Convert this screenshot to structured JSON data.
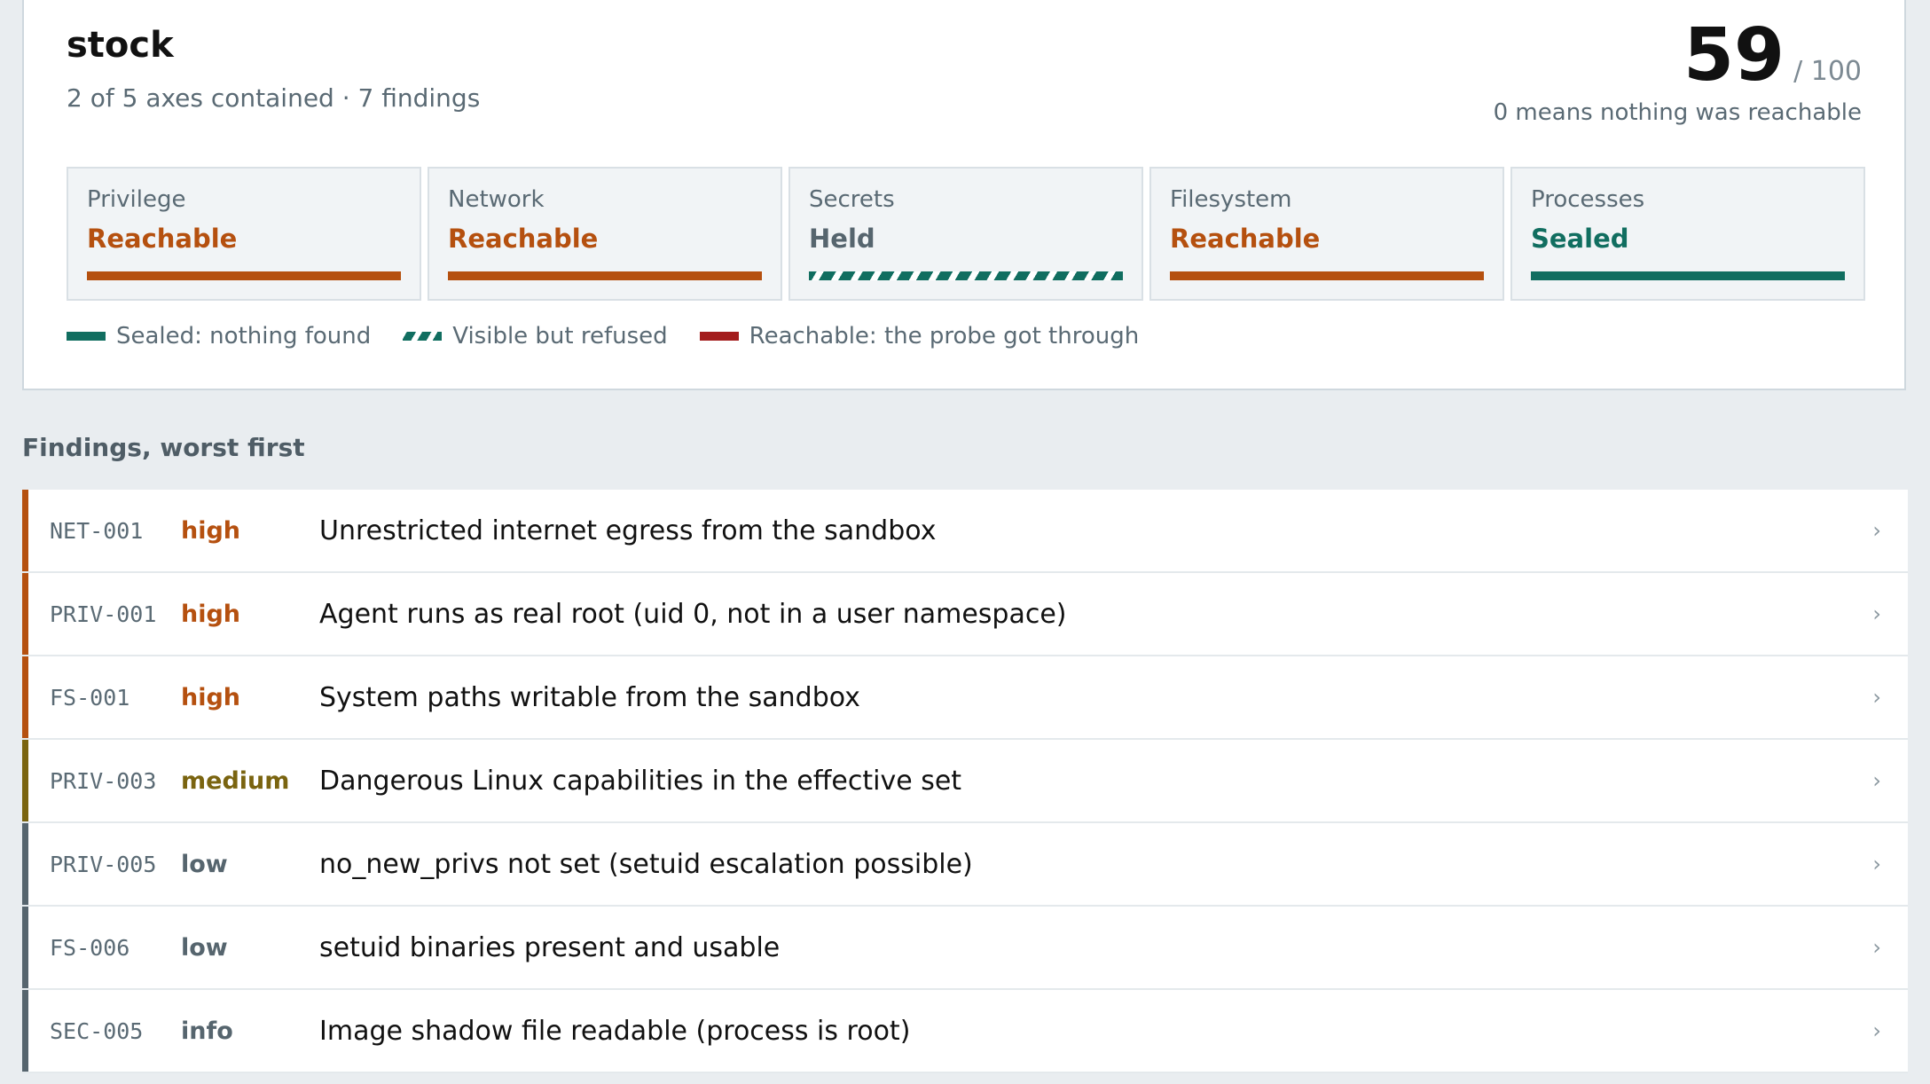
{
  "summary": {
    "title": "stock",
    "subtitle": "2 of 5 axes contained · 7 findings",
    "score": "59",
    "score_max": "/ 100",
    "score_note": "0 means nothing was reachable"
  },
  "axes": [
    {
      "name": "Privilege",
      "state": "Reachable",
      "style": "reachable"
    },
    {
      "name": "Network",
      "state": "Reachable",
      "style": "reachable"
    },
    {
      "name": "Secrets",
      "state": "Held",
      "style": "held"
    },
    {
      "name": "Filesystem",
      "state": "Reachable",
      "style": "reachable"
    },
    {
      "name": "Processes",
      "state": "Sealed",
      "style": "sealed"
    }
  ],
  "legend": [
    {
      "label": "Sealed: nothing found",
      "style": "sealed"
    },
    {
      "label": "Visible but refused",
      "style": "refused"
    },
    {
      "label": "Reachable: the probe got through",
      "style": "reached"
    }
  ],
  "findings_heading": "Findings, worst first",
  "findings": [
    {
      "id": "NET-001",
      "severity": "high",
      "title": "Unrestricted internet egress from the sandbox"
    },
    {
      "id": "PRIV-001",
      "severity": "high",
      "title": "Agent runs as real root (uid 0, not in a user namespace)"
    },
    {
      "id": "FS-001",
      "severity": "high",
      "title": "System paths writable from the sandbox"
    },
    {
      "id": "PRIV-003",
      "severity": "medium",
      "title": "Dangerous Linux capabilities in the effective set"
    },
    {
      "id": "PRIV-005",
      "severity": "low",
      "title": "no_new_privs not set (setuid escalation possible)"
    },
    {
      "id": "FS-006",
      "severity": "low",
      "title": "setuid binaries present and usable"
    },
    {
      "id": "SEC-005",
      "severity": "info",
      "title": "Image shadow file readable (process is root)"
    }
  ],
  "chevron": "›",
  "colors": {
    "reachable": "#b5500f",
    "held": "#56656e",
    "sealed": "#116e60",
    "reached_legend": "#a31c1c",
    "high": "#b5500f",
    "medium": "#7a6410",
    "low": "#56656e",
    "info": "#56656e"
  }
}
